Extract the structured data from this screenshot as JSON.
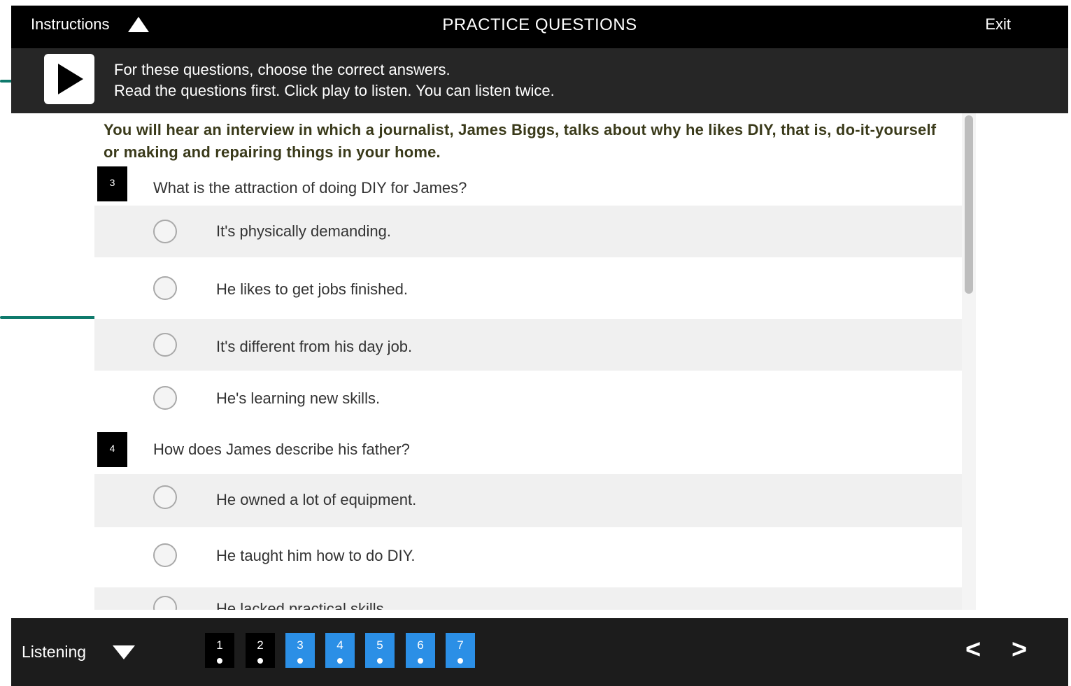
{
  "header": {
    "instructions_label": "Instructions",
    "title": "PRACTICE QUESTIONS",
    "exit_label": "Exit"
  },
  "instructions": {
    "line1": "For these questions, choose the correct answers.",
    "line2": "Read the questions first. Click play to listen. You can listen twice."
  },
  "task": {
    "intro": "You will hear an interview in which a journalist, James Biggs, talks about why he likes DIY, that is, do-it-yourself or making and repairing things in your home."
  },
  "questions": [
    {
      "number": "3",
      "text": "What is the attraction of doing DIY for James?",
      "options": [
        "It's physically demanding.",
        "He likes to get jobs finished.",
        "It's different from his day job.",
        "He's learning new skills."
      ]
    },
    {
      "number": "4",
      "text": "How does James describe his father?",
      "options": [
        "He owned a lot of equipment.",
        "He taught him how to do DIY.",
        "He lacked practical skills"
      ]
    }
  ],
  "footer": {
    "section_label": "Listening",
    "question_nav": [
      "1",
      "2",
      "3",
      "4",
      "5",
      "6",
      "7"
    ],
    "prev": "<",
    "next": ">"
  },
  "colors": {
    "accent_callout": "#0f7a6c",
    "nav_pending": "#2b8fe6"
  }
}
